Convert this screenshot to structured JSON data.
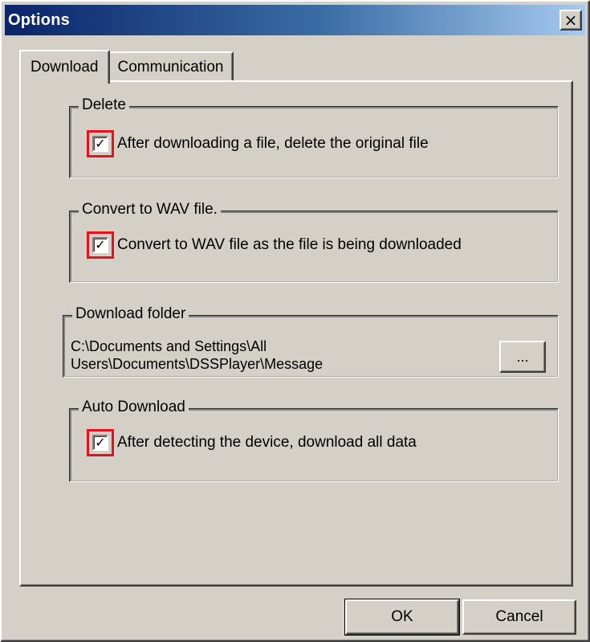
{
  "window": {
    "title": "Options",
    "close_glyph": "×"
  },
  "tabs": [
    {
      "label": "Download",
      "active": true
    },
    {
      "label": "Communication",
      "active": false
    }
  ],
  "groups": {
    "delete": {
      "title": "Delete",
      "checkbox_label": "After downloading a file, delete the original file",
      "checked": true
    },
    "convert": {
      "title": "Convert to WAV file.",
      "checkbox_label": "Convert to WAV file as the file is being downloaded",
      "checked": true
    },
    "download_folder": {
      "title": "Download folder",
      "path_line1": "C:\\Documents and Settings\\All",
      "path_line2": "Users\\Documents\\DSSPlayer\\Message",
      "browse_label": "..."
    },
    "auto_download": {
      "title": "Auto Download",
      "checkbox_label": "After detecting the device, download all data",
      "checked": true
    }
  },
  "checkmark_glyph": "✓",
  "buttons": {
    "ok": "OK",
    "cancel": "Cancel"
  },
  "colors": {
    "titlebar_start": "#0a246a",
    "dialog_bg": "#d4d0c8",
    "highlight": "#e8111b"
  }
}
